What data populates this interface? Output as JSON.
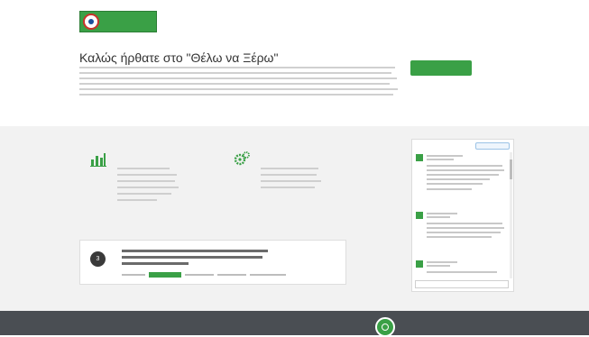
{
  "header": {
    "account_links": [
      "",
      ""
    ],
    "nav": [
      "",
      "",
      "",
      "",
      ""
    ]
  },
  "hero": {
    "title": "Καλώς ήρθατε στο \"Θέλω να Ξέρω\"",
    "cta_label": ""
  },
  "features": [
    {
      "title_line1": "",
      "title_line2": "",
      "icon": "bar-chart-icon"
    },
    {
      "title_line1": "",
      "title_line2": "",
      "icon": "gears-icon"
    }
  ],
  "top_questions": {
    "heading": "",
    "items": [
      {
        "rank": "3"
      }
    ]
  },
  "twitter": {
    "title": ""
  },
  "footer": {
    "col1_title": "",
    "col2_title": ""
  },
  "colors": {
    "accent": "#3aa046",
    "footer_bg": "#4a4e53",
    "band_bg": "#f2f2f2"
  }
}
